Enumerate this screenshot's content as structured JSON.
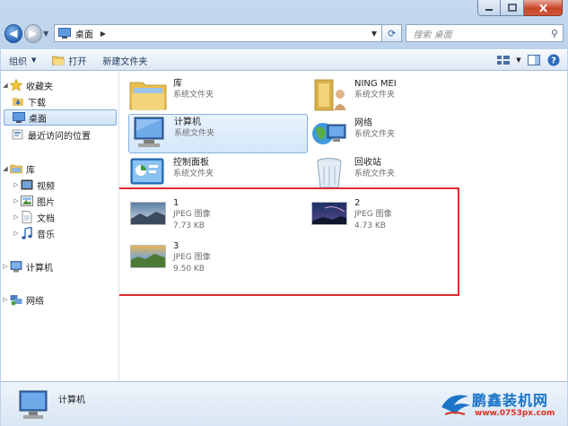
{
  "address": {
    "location": "桌面"
  },
  "search": {
    "placeholder": "搜索 桌面"
  },
  "toolbar": {
    "organize": "组织",
    "open": "打开",
    "new_folder": "新建文件夹"
  },
  "nav": {
    "favorites": "收藏夹",
    "downloads": "下载",
    "desktop": "桌面",
    "recent": "最近访问的位置",
    "libraries": "库",
    "videos": "视频",
    "pictures": "图片",
    "documents": "文档",
    "music": "音乐",
    "computer": "计算机",
    "network": "网络"
  },
  "items": [
    {
      "name": "库",
      "sub": "系统文件夹"
    },
    {
      "name": "NING MEI",
      "sub": "系统文件夹"
    },
    {
      "name": "计算机",
      "sub": "系统文件夹"
    },
    {
      "name": "网络",
      "sub": "系统文件夹"
    },
    {
      "name": "控制面板",
      "sub": "系统文件夹"
    },
    {
      "name": "回收站",
      "sub": "系统文件夹"
    },
    {
      "name": "1",
      "type": "JPEG 图像",
      "size": "7.73 KB"
    },
    {
      "name": "2",
      "type": "JPEG 图像",
      "size": "4.73 KB"
    },
    {
      "name": "3",
      "type": "JPEG 图像",
      "size": "9.50 KB"
    }
  ],
  "details": {
    "name": "计算机"
  },
  "watermark": {
    "brand": "鹏鑫装机网",
    "url": "www.0753px.com"
  },
  "colors": {
    "highlight": "#e22b30",
    "accent": "#2a64b8"
  }
}
